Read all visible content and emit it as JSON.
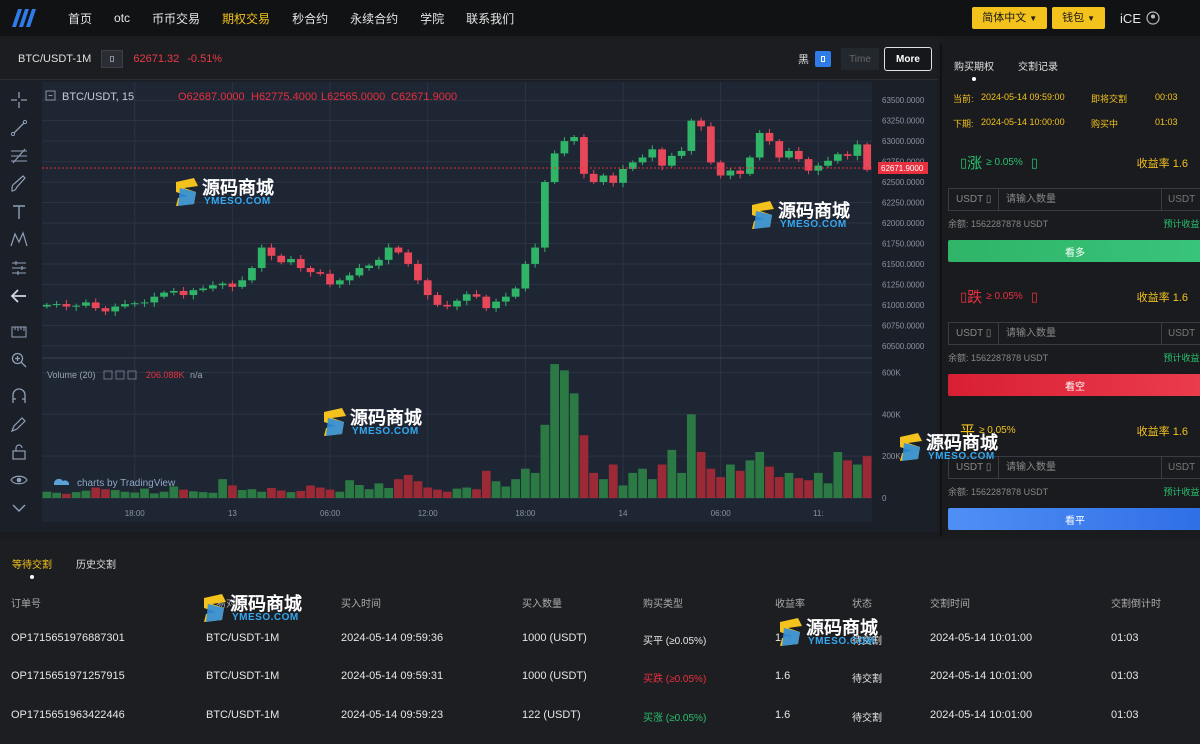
{
  "nav": {
    "items": [
      "首页",
      "otc",
      "币币交易",
      "期权交易",
      "秒合约",
      "永续合约",
      "学院",
      "联系我们"
    ],
    "active_index": 3,
    "language": "简体中文",
    "wallet": "钱包",
    "user": "iCE"
  },
  "chart_header": {
    "symbol": "BTC/USDT-1M",
    "price": "62671.32",
    "change": "-0.51%",
    "theme_label": "黑",
    "time_label": "Time",
    "more_label": "More"
  },
  "chart_data": {
    "type": "candlestick",
    "title": "BTC/USDT, 15",
    "ohlc_legend": {
      "open": "O62687.0000",
      "high": "H62775.4000",
      "low": "L62565.0000",
      "close": "C62671.9000"
    },
    "current_price_label": "62671.9000",
    "current_price": 62671.9,
    "price_axis": {
      "ylim": [
        60400,
        63600
      ],
      "ticks": [
        "63500.0000",
        "63250.0000",
        "63000.0000",
        "62750.0000",
        "62500.0000",
        "62250.0000",
        "62000.0000",
        "61750.0000",
        "61500.0000",
        "61250.0000",
        "61000.0000",
        "60750.0000",
        "60500.0000"
      ],
      "tick_values": [
        63500,
        63250,
        63000,
        62750,
        62500,
        62250,
        62000,
        61750,
        61500,
        61250,
        61000,
        60750,
        60500
      ]
    },
    "volume_axis": {
      "ylim": [
        0,
        650000
      ],
      "ticks": [
        "600K",
        "400K",
        "200K",
        "0"
      ],
      "tick_values": [
        600000,
        400000,
        200000,
        0
      ]
    },
    "volume_legend": "Volume (20)",
    "volume_value": "206.088K",
    "volume_ma": "n/a",
    "time_ticks": [
      "18:00",
      "13",
      "06:00",
      "12:00",
      "18:00",
      "14",
      "06:00",
      "11:"
    ],
    "time_tick_index": [
      9,
      19,
      29,
      39,
      49,
      59,
      69,
      79
    ],
    "grid": true,
    "close_series": [
      61000,
      61010,
      60980,
      60990,
      61030,
      60960,
      60920,
      60980,
      61010,
      61020,
      61030,
      61100,
      61150,
      61170,
      61120,
      61180,
      61200,
      61240,
      61260,
      61220,
      61300,
      61450,
      61700,
      61600,
      61520,
      61560,
      61450,
      61400,
      61380,
      61250,
      61300,
      61360,
      61450,
      61480,
      61550,
      61700,
      61640,
      61500,
      61300,
      61120,
      61000,
      60980,
      61050,
      61130,
      61100,
      60960,
      61040,
      61100,
      61200,
      61500,
      61700,
      62500,
      62850,
      63000,
      63050,
      62600,
      62500,
      62580,
      62490,
      62660,
      62740,
      62800,
      62900,
      62700,
      62820,
      62880,
      63250,
      63180,
      62740,
      62580,
      62640,
      62600,
      62800,
      63100,
      63000,
      62800,
      62880,
      62780,
      62640,
      62700,
      62760,
      62840,
      62820,
      62960,
      62650
    ],
    "volume_series": [
      30000,
      25000,
      20000,
      28000,
      35000,
      50000,
      42000,
      38000,
      30000,
      26000,
      45000,
      22000,
      30000,
      55000,
      40000,
      32000,
      28000,
      25000,
      90000,
      60000,
      38000,
      42000,
      30000,
      48000,
      36000,
      28000,
      34000,
      60000,
      50000,
      40000,
      30000,
      85000,
      62000,
      42000,
      70000,
      48000,
      90000,
      110000,
      80000,
      50000,
      40000,
      30000,
      45000,
      50000,
      42000,
      130000,
      80000,
      55000,
      90000,
      140000,
      120000,
      350000,
      640000,
      610000,
      500000,
      300000,
      120000,
      90000,
      160000,
      60000,
      120000,
      140000,
      90000,
      160000,
      230000,
      120000,
      400000,
      220000,
      140000,
      100000,
      160000,
      130000,
      180000,
      220000,
      150000,
      100000,
      120000,
      95000,
      85000,
      120000,
      70000,
      220000,
      180000,
      160000,
      200000
    ],
    "attribution": "charts by TradingView"
  },
  "right_panel": {
    "tabs": [
      "购买期权",
      "交割记录"
    ],
    "current_label": "当前:",
    "current_time": "2024-05-14 09:59:00",
    "settle_label": "即将交割",
    "settle_countdown": "00:03",
    "next_label": "下期:",
    "next_time": "2024-05-14 10:00:00",
    "buying_label": "购买中",
    "buying_countdown": "01:03",
    "options": [
      {
        "label": "涨",
        "pct": "≥ 0.05%",
        "yield_label": "收益率",
        "yield": "1.6",
        "color": "#28c06e",
        "button": "看多",
        "btn_color": "#2dbd6e"
      },
      {
        "label": "跌",
        "pct": "≥ 0.05%",
        "yield_label": "收益率",
        "yield": "1.6",
        "color": "#e8303f",
        "button": "看空",
        "btn_color": "#e33045"
      },
      {
        "label": "平",
        "pct": "≥ 0.05%",
        "yield_label": "收益率",
        "yield": "1.6",
        "color": "#f3c21d",
        "button": "看平",
        "btn_color": "#3d7cf0"
      }
    ],
    "input_unit": "USDT",
    "input_placeholder": "请输入数量",
    "balance_label": "余额:",
    "balance": "1562287878 USDT",
    "expected_label": "预计收益:"
  },
  "orders": {
    "tabs": [
      "等待交割",
      "历史交割"
    ],
    "columns": [
      "订单号",
      "交易对",
      "买入时间",
      "买入数量",
      "购买类型",
      "收益率",
      "状态",
      "交割时间",
      "交割倒计时"
    ],
    "rows": [
      {
        "id": "OP1715651976887301",
        "pair": "BTC/USDT-1M",
        "buy_time": "2024-05-14 09:59:36",
        "qty": "1000 (USDT)",
        "type": "买平 (≥0.05%)",
        "type_color": "#e6e6e6",
        "yield": "1.6",
        "status": "待交割",
        "settle_time": "2024-05-14 10:01:00",
        "countdown": "01:03"
      },
      {
        "id": "OP1715651971257915",
        "pair": "BTC/USDT-1M",
        "buy_time": "2024-05-14 09:59:31",
        "qty": "1000 (USDT)",
        "type": "买跌 (≥0.05%)",
        "type_color": "#e8303f",
        "yield": "1.6",
        "status": "待交割",
        "settle_time": "2024-05-14 10:01:00",
        "countdown": "01:03"
      },
      {
        "id": "OP1715651963422446",
        "pair": "BTC/USDT-1M",
        "buy_time": "2024-05-14 09:59:23",
        "qty": "122 (USDT)",
        "type": "买涨 (≥0.05%)",
        "type_color": "#28c06e",
        "yield": "1.6",
        "status": "待交割",
        "settle_time": "2024-05-14 10:01:00",
        "countdown": "01:03"
      }
    ]
  },
  "watermark": {
    "cn": "源码商城",
    "en": "YMESO.COM"
  }
}
